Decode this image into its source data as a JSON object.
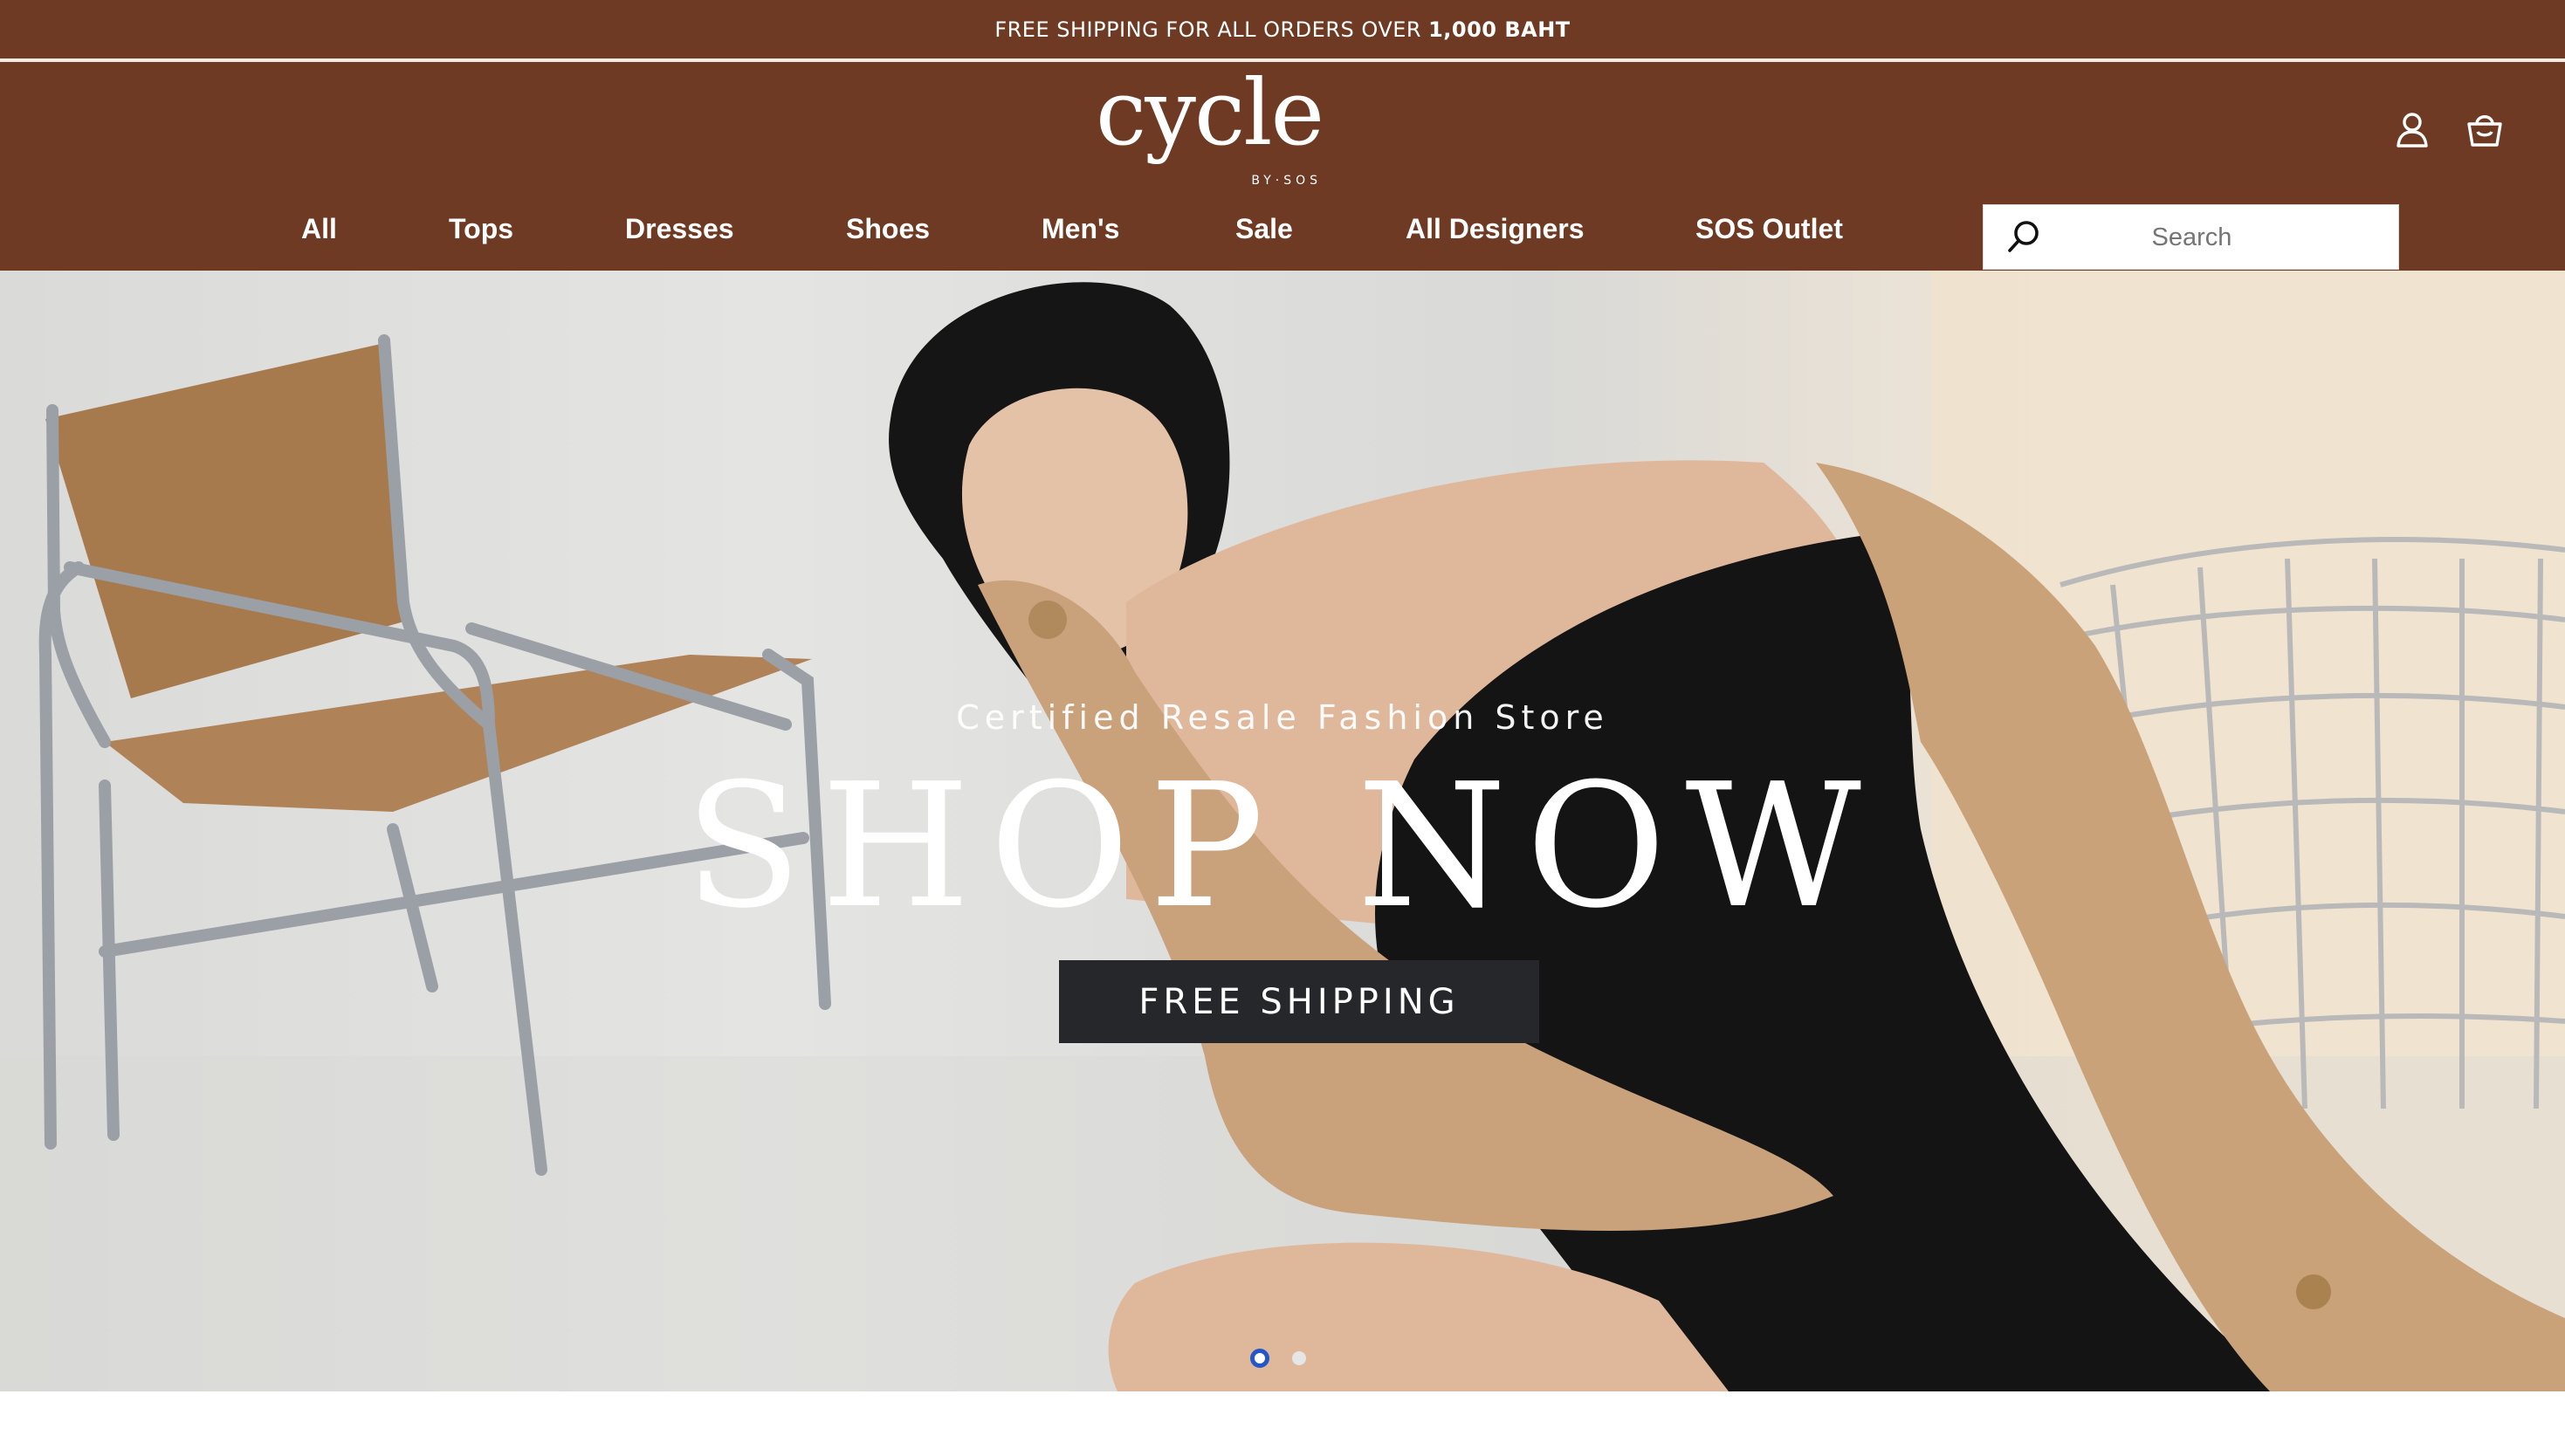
{
  "announcement": {
    "text": "FREE SHIPPING FOR ALL ORDERS OVER",
    "highlight": "1,000 BAHT"
  },
  "logo": {
    "main": "cycle",
    "sub": "BY·SOS"
  },
  "header_icons": [
    "user-icon",
    "shopping-bag-icon"
  ],
  "nav": {
    "items": [
      {
        "label": "All"
      },
      {
        "label": "Tops"
      },
      {
        "label": "Dresses"
      },
      {
        "label": "Shoes"
      },
      {
        "label": "Men's"
      },
      {
        "label": "Sale"
      },
      {
        "label": "All Designers"
      },
      {
        "label": "SOS Outlet"
      }
    ]
  },
  "search": {
    "placeholder": "Search"
  },
  "hero": {
    "eyebrow": "Certified Resale Fashion Store",
    "title": "SHOP NOW",
    "cta": "FREE SHIPPING",
    "slides": {
      "total": 2,
      "active": 1
    }
  },
  "colors": {
    "brand_brown": "#6e3a23",
    "cta_dark": "#25272a",
    "dot_active": "#2356c9"
  }
}
